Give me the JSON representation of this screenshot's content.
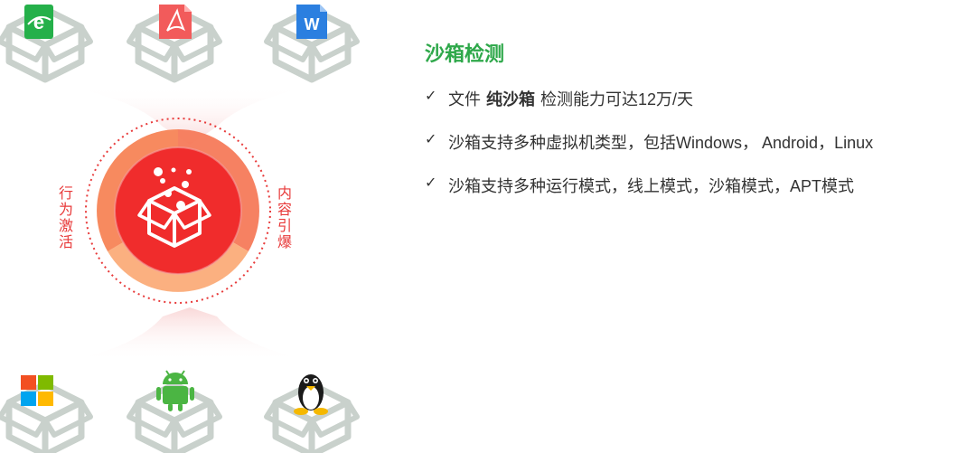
{
  "diagram": {
    "left_label": "行为激活",
    "right_label": "内容引爆",
    "top_icons": [
      "ie-icon",
      "pdf-icon",
      "word-icon"
    ],
    "bottom_icons": [
      "windows-icon",
      "android-icon",
      "linux-icon"
    ],
    "colors": {
      "accent_red": "#e83a3a",
      "inner_red": "#f02c2c",
      "ring_orange": "#f57a5a",
      "ring_peach": "#fbb080",
      "box_gray": "#c9d1cc"
    }
  },
  "section": {
    "title": "沙箱检测",
    "title_color": "#2ea84a",
    "features": [
      {
        "check": "✓",
        "parts": [
          "文件",
          "纯沙箱",
          "检测能力可达12万/天"
        ]
      },
      {
        "check": "✓",
        "text": "沙箱支持多种虚拟机类型，包括Windows， Android，Linux"
      },
      {
        "check": "✓",
        "text": "沙箱支持多种运行模式，线上模式，沙箱模式，APT模式"
      }
    ]
  }
}
